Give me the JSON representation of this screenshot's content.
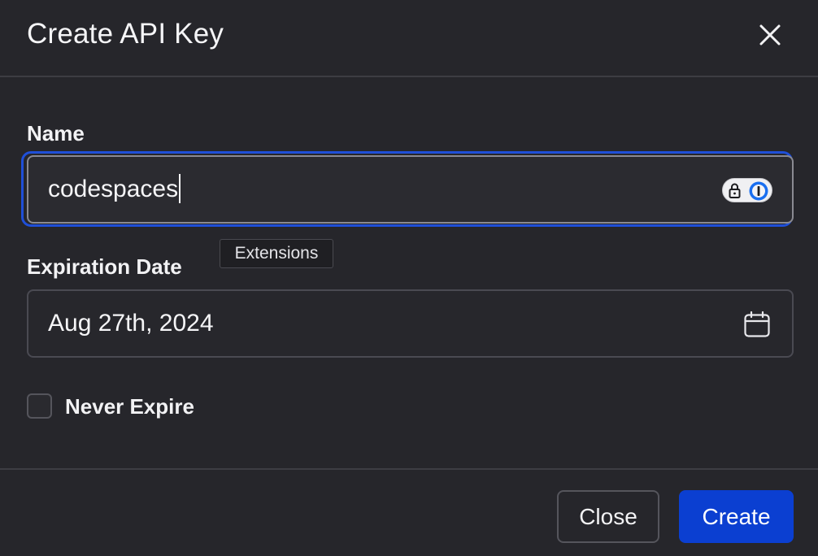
{
  "dialog": {
    "title": "Create API Key",
    "close_icon": "close-icon"
  },
  "form": {
    "name_label": "Name",
    "name_value": "codespaces",
    "password_manager_icon": "password-manager-icon",
    "tooltip": "Extensions",
    "expiration_label": "Expiration Date",
    "expiration_value": "Aug 27th, 2024",
    "calendar_icon": "calendar-icon",
    "never_expire_label": "Never Expire",
    "never_expire_checked": false
  },
  "footer": {
    "close_label": "Close",
    "create_label": "Create"
  },
  "colors": {
    "background": "#26262b",
    "focus_ring": "#1f4fd8",
    "primary_button": "#0b3fd1"
  }
}
